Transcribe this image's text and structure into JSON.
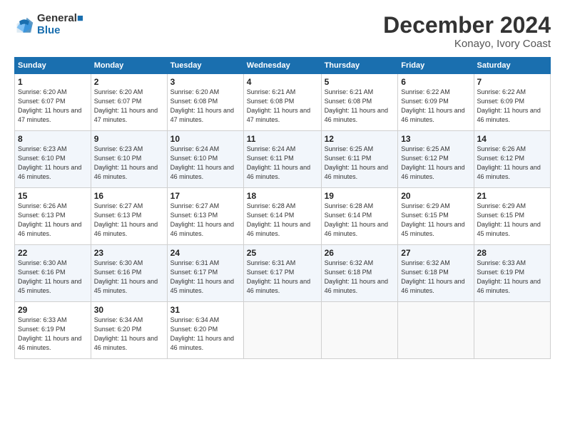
{
  "logo": {
    "line1": "General",
    "line2": "Blue"
  },
  "title": "December 2024",
  "location": "Konayo, Ivory Coast",
  "weekdays": [
    "Sunday",
    "Monday",
    "Tuesday",
    "Wednesday",
    "Thursday",
    "Friday",
    "Saturday"
  ],
  "weeks": [
    [
      {
        "day": "1",
        "rise": "6:20 AM",
        "set": "6:07 PM",
        "daylight": "11 hours and 47 minutes."
      },
      {
        "day": "2",
        "rise": "6:20 AM",
        "set": "6:07 PM",
        "daylight": "11 hours and 47 minutes."
      },
      {
        "day": "3",
        "rise": "6:20 AM",
        "set": "6:08 PM",
        "daylight": "11 hours and 47 minutes."
      },
      {
        "day": "4",
        "rise": "6:21 AM",
        "set": "6:08 PM",
        "daylight": "11 hours and 47 minutes."
      },
      {
        "day": "5",
        "rise": "6:21 AM",
        "set": "6:08 PM",
        "daylight": "11 hours and 46 minutes."
      },
      {
        "day": "6",
        "rise": "6:22 AM",
        "set": "6:09 PM",
        "daylight": "11 hours and 46 minutes."
      },
      {
        "day": "7",
        "rise": "6:22 AM",
        "set": "6:09 PM",
        "daylight": "11 hours and 46 minutes."
      }
    ],
    [
      {
        "day": "8",
        "rise": "6:23 AM",
        "set": "6:10 PM",
        "daylight": "11 hours and 46 minutes."
      },
      {
        "day": "9",
        "rise": "6:23 AM",
        "set": "6:10 PM",
        "daylight": "11 hours and 46 minutes."
      },
      {
        "day": "10",
        "rise": "6:24 AM",
        "set": "6:10 PM",
        "daylight": "11 hours and 46 minutes."
      },
      {
        "day": "11",
        "rise": "6:24 AM",
        "set": "6:11 PM",
        "daylight": "11 hours and 46 minutes."
      },
      {
        "day": "12",
        "rise": "6:25 AM",
        "set": "6:11 PM",
        "daylight": "11 hours and 46 minutes."
      },
      {
        "day": "13",
        "rise": "6:25 AM",
        "set": "6:12 PM",
        "daylight": "11 hours and 46 minutes."
      },
      {
        "day": "14",
        "rise": "6:26 AM",
        "set": "6:12 PM",
        "daylight": "11 hours and 46 minutes."
      }
    ],
    [
      {
        "day": "15",
        "rise": "6:26 AM",
        "set": "6:13 PM",
        "daylight": "11 hours and 46 minutes."
      },
      {
        "day": "16",
        "rise": "6:27 AM",
        "set": "6:13 PM",
        "daylight": "11 hours and 46 minutes."
      },
      {
        "day": "17",
        "rise": "6:27 AM",
        "set": "6:13 PM",
        "daylight": "11 hours and 46 minutes."
      },
      {
        "day": "18",
        "rise": "6:28 AM",
        "set": "6:14 PM",
        "daylight": "11 hours and 46 minutes."
      },
      {
        "day": "19",
        "rise": "6:28 AM",
        "set": "6:14 PM",
        "daylight": "11 hours and 46 minutes."
      },
      {
        "day": "20",
        "rise": "6:29 AM",
        "set": "6:15 PM",
        "daylight": "11 hours and 45 minutes."
      },
      {
        "day": "21",
        "rise": "6:29 AM",
        "set": "6:15 PM",
        "daylight": "11 hours and 45 minutes."
      }
    ],
    [
      {
        "day": "22",
        "rise": "6:30 AM",
        "set": "6:16 PM",
        "daylight": "11 hours and 45 minutes."
      },
      {
        "day": "23",
        "rise": "6:30 AM",
        "set": "6:16 PM",
        "daylight": "11 hours and 45 minutes."
      },
      {
        "day": "24",
        "rise": "6:31 AM",
        "set": "6:17 PM",
        "daylight": "11 hours and 45 minutes."
      },
      {
        "day": "25",
        "rise": "6:31 AM",
        "set": "6:17 PM",
        "daylight": "11 hours and 46 minutes."
      },
      {
        "day": "26",
        "rise": "6:32 AM",
        "set": "6:18 PM",
        "daylight": "11 hours and 46 minutes."
      },
      {
        "day": "27",
        "rise": "6:32 AM",
        "set": "6:18 PM",
        "daylight": "11 hours and 46 minutes."
      },
      {
        "day": "28",
        "rise": "6:33 AM",
        "set": "6:19 PM",
        "daylight": "11 hours and 46 minutes."
      }
    ],
    [
      {
        "day": "29",
        "rise": "6:33 AM",
        "set": "6:19 PM",
        "daylight": "11 hours and 46 minutes."
      },
      {
        "day": "30",
        "rise": "6:34 AM",
        "set": "6:20 PM",
        "daylight": "11 hours and 46 minutes."
      },
      {
        "day": "31",
        "rise": "6:34 AM",
        "set": "6:20 PM",
        "daylight": "11 hours and 46 minutes."
      },
      null,
      null,
      null,
      null
    ]
  ]
}
